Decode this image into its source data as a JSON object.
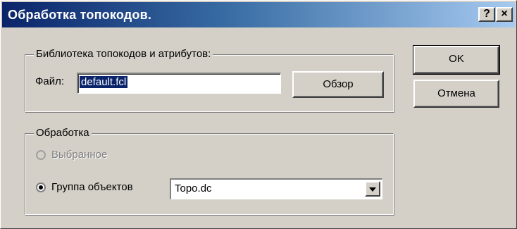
{
  "window": {
    "title": "Обработка топокодов.",
    "help_button": "?",
    "close_button": "×"
  },
  "library_group": {
    "legend": "Библиотека топокодов и атрибутов:",
    "file_label": "Файл:",
    "file_value": "default.fcl",
    "browse_button": "Обзор"
  },
  "processing_group": {
    "legend": "Обработка",
    "options": [
      {
        "label": "Выбранное",
        "selected": false,
        "enabled": false
      },
      {
        "label": "Группа объектов",
        "selected": true,
        "enabled": true
      }
    ],
    "group_select": {
      "value": "Topo.dc"
    }
  },
  "actions": {
    "ok": "OK",
    "cancel": "Отмена"
  },
  "colors": {
    "face": "#d4d0c8",
    "title_start": "#0a246a",
    "title_end": "#a6caf0",
    "selection": "#0a246a"
  }
}
